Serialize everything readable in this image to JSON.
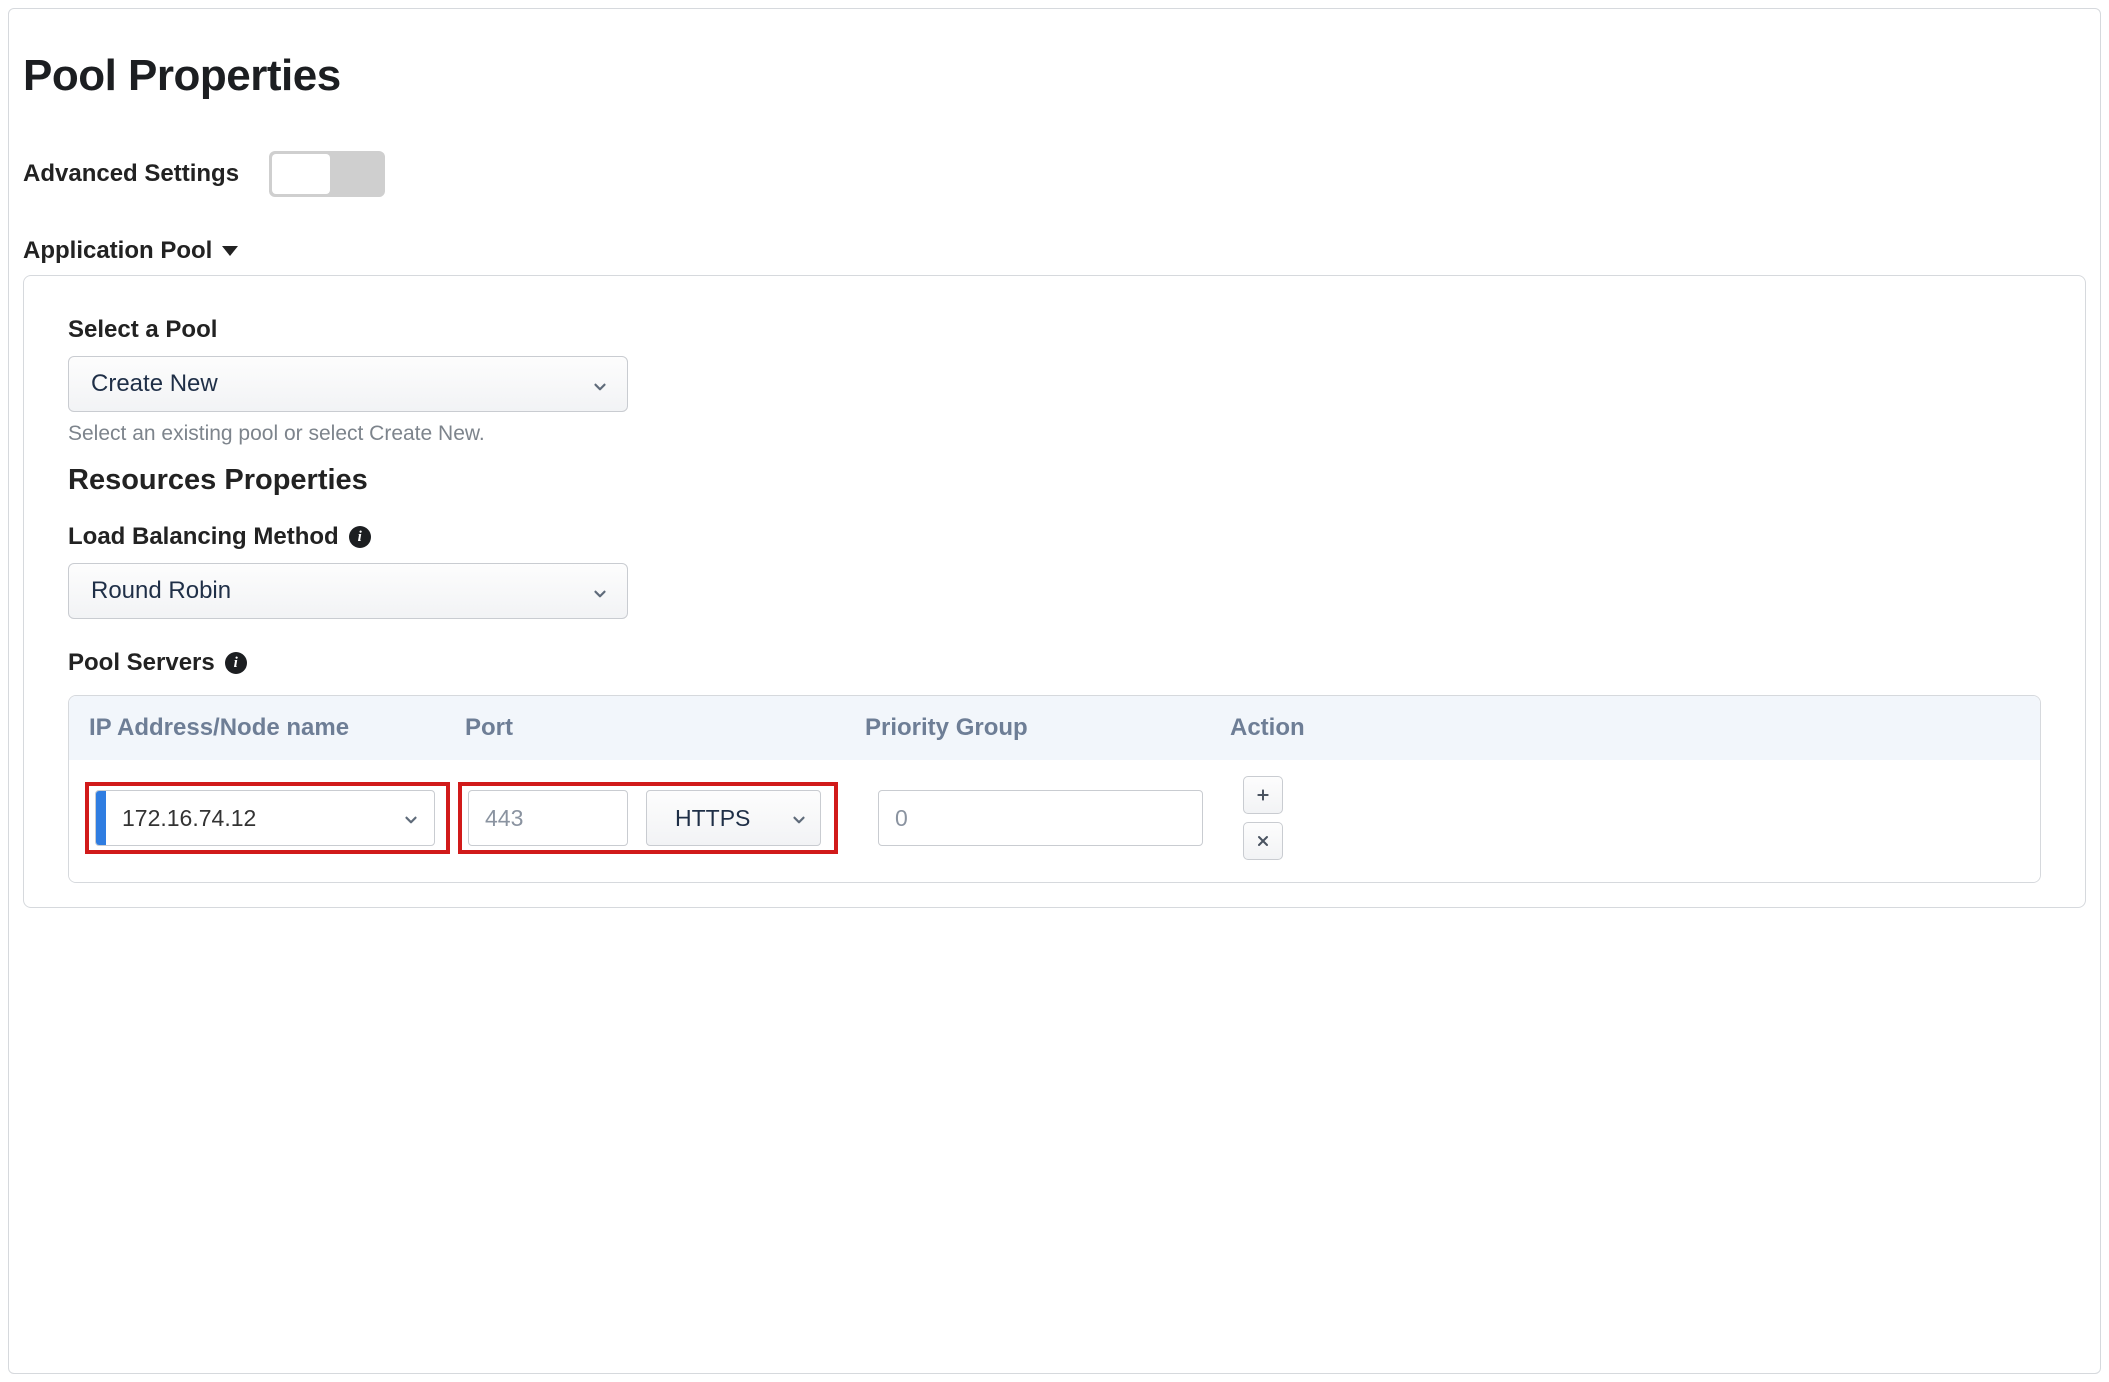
{
  "page": {
    "title": "Pool Properties",
    "advanced_label": "Advanced Settings",
    "section_title": "Application Pool"
  },
  "pool": {
    "select_label": "Select a Pool",
    "select_value": "Create New",
    "help_text": "Select an existing pool or select Create New.",
    "resources_heading": "Resources Properties"
  },
  "lb": {
    "label": "Load Balancing Method",
    "value": "Round Robin"
  },
  "servers": {
    "label": "Pool Servers",
    "columns": {
      "ip": "IP Address/Node name",
      "port": "Port",
      "priority": "Priority Group",
      "action": "Action"
    },
    "rows": [
      {
        "ip": "172.16.74.12",
        "port": "443",
        "protocol": "HTTPS",
        "priority": "0"
      }
    ]
  }
}
